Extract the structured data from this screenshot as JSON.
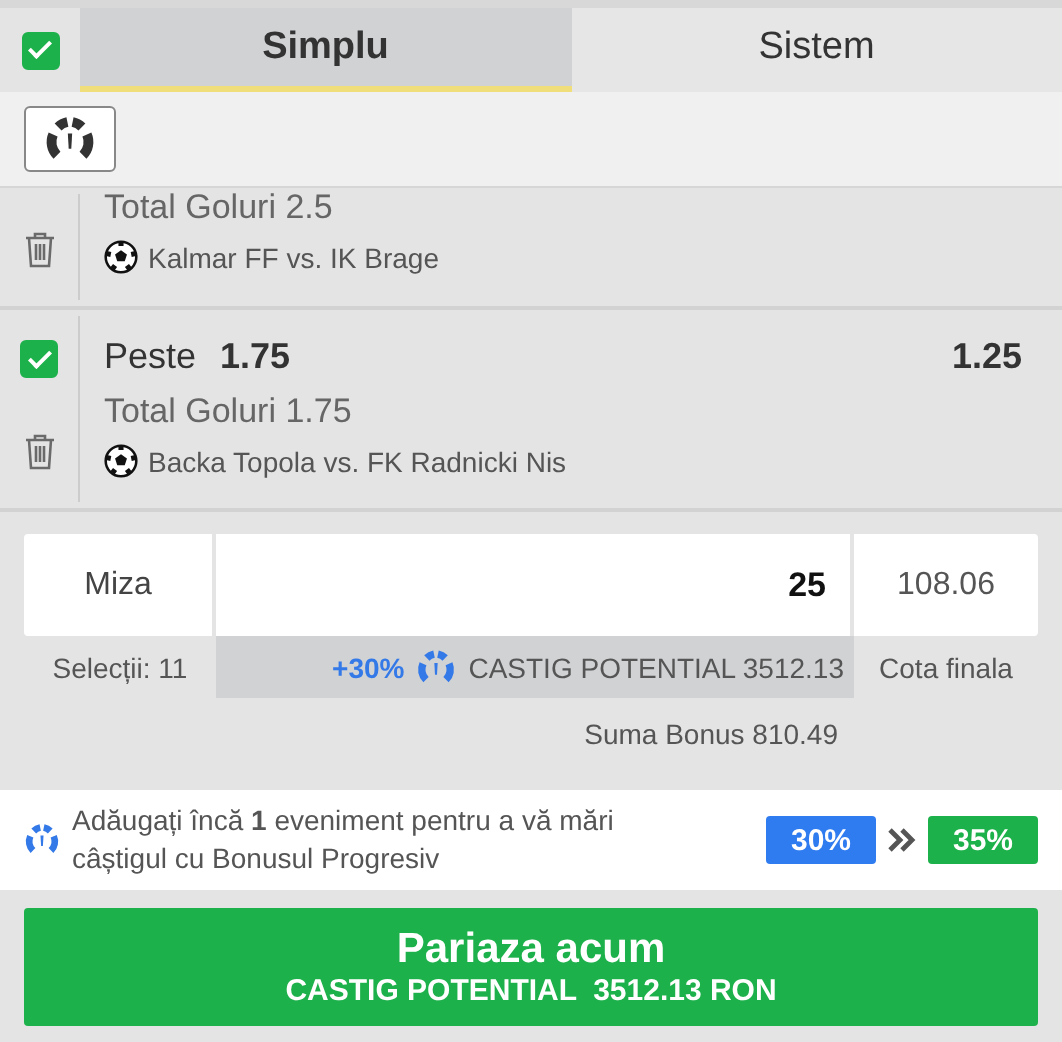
{
  "header": {
    "all_checked": true,
    "tabs": [
      {
        "label": "Simplu",
        "selected": true
      },
      {
        "label": "Sistem",
        "selected": false
      }
    ]
  },
  "bets": [
    {
      "market": "Total Goluri 2.5",
      "match": "Kalmar FF vs. IK Brage"
    },
    {
      "checked": true,
      "selection": "Peste",
      "line": "1.75",
      "odds": "1.25",
      "market": "Total Goluri 1.75",
      "match": "Backa Topola vs. FK Radnicki Nis"
    }
  ],
  "stake": {
    "label": "Miza",
    "value": "25",
    "total_odds": "108.06",
    "selections": "Selecții: 11",
    "bonus_percent": "+30%",
    "potential": "CASTIG POTENTIAL 3512.13",
    "odds_label": "Cota finala",
    "bonus_sum": "Suma Bonus 810.49"
  },
  "promo": {
    "text": "Adăugați încă **1** eveniment pentru a vă mări câștigul cu Bonusul Progresiv",
    "current": "30%",
    "next": "35%"
  },
  "place_button": {
    "label": "Pariaza acum",
    "potential": "CASTIG POTENTIAL  3512.13 RON"
  }
}
